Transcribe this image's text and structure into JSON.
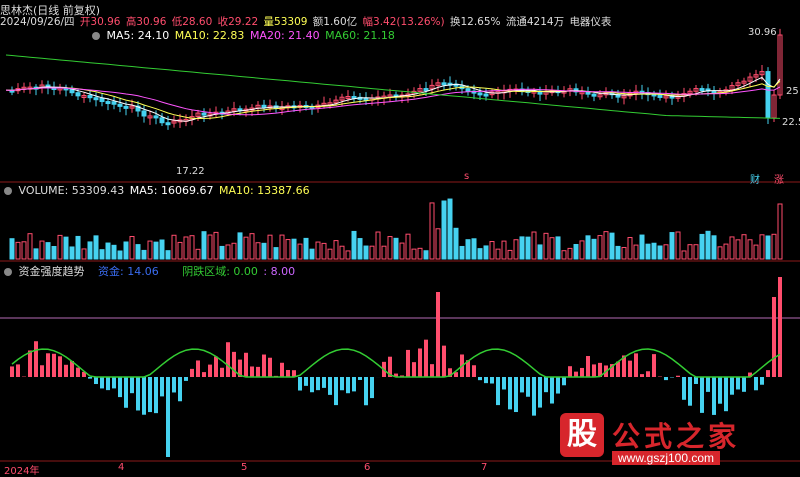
{
  "header": {
    "stock_name": "思林杰(日线 前复权)",
    "date": "2024/09/26/四",
    "open": "开30.96",
    "high": "高30.96",
    "low": "低28.60",
    "close": "收29.22",
    "volume": "量53309",
    "amount": "额1.60亿",
    "change": "幅3.42(13.26%)",
    "turnover": "换12.65%",
    "float": "流通4214万",
    "industry": "电器仪表"
  },
  "main_legend": {
    "ma5": "MA5: 24.10",
    "ma10": "MA10: 22.83",
    "ma20": "MA20: 21.40",
    "ma60": "MA60: 21.18"
  },
  "price_labels": {
    "high_mark": "30.96",
    "low_mark": "17.22",
    "right_mid": "25",
    "right_low": "22.5",
    "tag_cai": "财",
    "tag_zhang": "涨",
    "tag_s": "s"
  },
  "volume_legend": {
    "volume": "VOLUME: 53309.43",
    "ma5": "MA5: 16069.67",
    "ma10": "MA10: 13387.66"
  },
  "indicator_legend": {
    "title": "资金强度趋势",
    "funds": "资金: 14.06",
    "bear": "阴跌区域: 0.00",
    "bear2": ": 8.00"
  },
  "xaxis": {
    "year": "2024年",
    "m4": "4",
    "m5": "5",
    "m6": "6",
    "m7": "7"
  },
  "watermark": {
    "logo_char": "股",
    "brand": "公式之家",
    "url": "www.gszj100.com"
  },
  "colors": {
    "up": "#ff4d6d",
    "down": "#46d2f0",
    "ma5": "#ffffff",
    "ma10": "#ffff55",
    "ma20": "#ff55ff",
    "ma60": "#33cc33",
    "grid": "#8b1a1a",
    "bg": "#000000"
  }
}
